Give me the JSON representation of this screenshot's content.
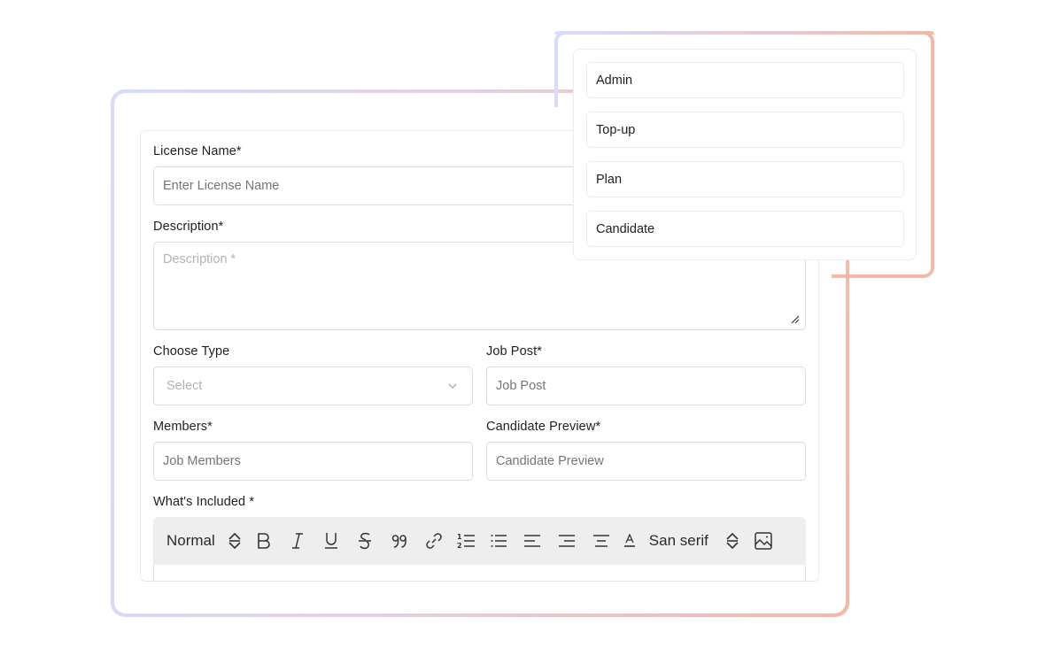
{
  "form": {
    "license_name": {
      "label": "License Name*",
      "placeholder": "Enter License Name",
      "value": ""
    },
    "description": {
      "label": "Description*",
      "placeholder": "Description *",
      "value": ""
    },
    "choose_type": {
      "label": "Choose Type",
      "selected": "Select"
    },
    "job_post": {
      "label": "Job Post*",
      "placeholder": "Job Post",
      "value": ""
    },
    "members": {
      "label": "Members*",
      "placeholder": "Job Members",
      "value": ""
    },
    "candidate_preview": {
      "label": "Candidate Preview*",
      "placeholder": "Candidate Preview",
      "value": ""
    },
    "whats_included": {
      "label": "What's Included *",
      "toolbar": {
        "heading_select": "Normal",
        "font_select": "San serif",
        "icons": [
          "updown-select-icon",
          "bold-icon",
          "italic-icon",
          "underline-icon",
          "strikethrough-icon",
          "blockquote-icon",
          "link-icon",
          "ordered-list-icon",
          "bullet-list-icon",
          "align-left-icon",
          "align-right-icon",
          "align-center-icon",
          "text-color-icon",
          "updown-select-icon",
          "image-icon"
        ]
      }
    }
  },
  "type_options": {
    "items": [
      "Admin",
      "Top-up",
      "Plan",
      "Candidate"
    ]
  },
  "colors": {
    "gradient_start": "#d6dcfb",
    "gradient_end": "#f3b8a6",
    "toolbar_bg": "#eeeeee",
    "placeholder": "#b3b3b3",
    "border": "#dcdcdc"
  }
}
